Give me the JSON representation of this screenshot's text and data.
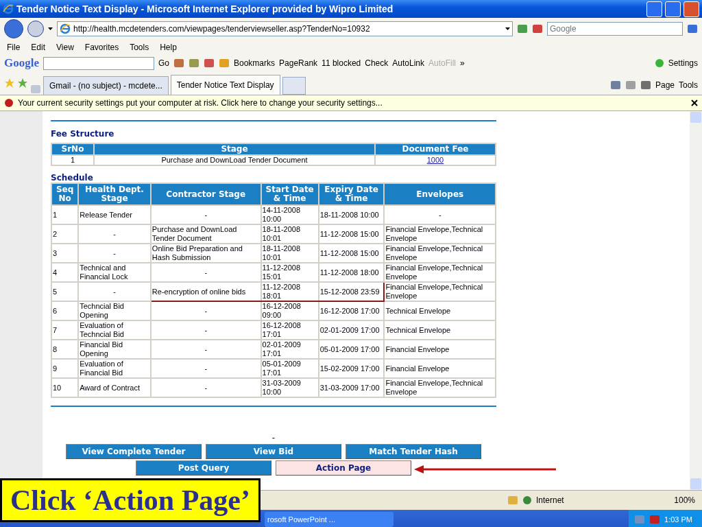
{
  "window": {
    "title": "Tender Notice Text Display - Microsoft Internet Explorer provided by Wipro Limited"
  },
  "address_bar": {
    "url": "http://health.mcdetenders.com/viewpages/tenderviewseller.asp?TenderNo=10932",
    "search_placeholder": "Google"
  },
  "menu": [
    "File",
    "Edit",
    "View",
    "Favorites",
    "Tools",
    "Help"
  ],
  "google_toolbar": {
    "logo": "Google",
    "go": "Go",
    "items": [
      {
        "label": "Bookmarks",
        "disabled": false
      },
      {
        "label": "PageRank",
        "disabled": false
      },
      {
        "label": "11 blocked",
        "disabled": false
      },
      {
        "label": "Check",
        "disabled": false
      },
      {
        "label": "AutoLink",
        "disabled": false
      },
      {
        "label": "AutoFill",
        "disabled": true
      }
    ],
    "more": "»",
    "settings": "Settings"
  },
  "tabs": [
    {
      "label": "Gmail - (no subject) - mcdete...",
      "selected": false
    },
    {
      "label": "Tender Notice Text Display",
      "selected": true
    }
  ],
  "command_bar": [
    "Page",
    "Tools"
  ],
  "security_bar": {
    "message": "Your current security settings put your computer at risk. Click here to change your security settings..."
  },
  "fee_structure": {
    "heading": "Fee Structure",
    "columns": [
      "SrNo",
      "Stage",
      "Document Fee"
    ],
    "rows": [
      [
        "1",
        "Purchase and DownLoad Tender Document",
        "1000"
      ]
    ]
  },
  "schedule": {
    "heading": "Schedule",
    "columns": [
      "Seq No",
      "Health Dept. Stage",
      "Contractor Stage",
      "Start Date & Time",
      "Expiry Date & Time",
      "Envelopes"
    ],
    "rows": [
      {
        "cells": [
          "1",
          "Release Tender",
          "-",
          "14-11-2008 10:00",
          "18-11-2008 10:00",
          "-"
        ],
        "highlighted": false
      },
      {
        "cells": [
          "2",
          "-",
          "Purchase and DownLoad Tender Document",
          "18-11-2008 10:01",
          "11-12-2008 15:00",
          "Financial Envelope,Technical Envelope"
        ],
        "highlighted": false
      },
      {
        "cells": [
          "3",
          "-",
          "Online Bid Preparation and Hash Submission",
          "18-11-2008 10:01",
          "11-12-2008 15:00",
          "Financial Envelope,Technical Envelope"
        ],
        "highlighted": false
      },
      {
        "cells": [
          "4",
          "Technical and Financial Lock",
          "-",
          "11-12-2008 15:01",
          "11-12-2008 18:00",
          "Financial Envelope,Technical Envelope"
        ],
        "highlighted": false
      },
      {
        "cells": [
          "5",
          "-",
          "Re-encryption of online bids",
          "11-12-2008 18:01",
          "15-12-2008 23:59",
          "Financial Envelope,Technical Envelope"
        ],
        "highlighted": true
      },
      {
        "cells": [
          "6",
          "Techncial Bid Opening",
          "-",
          "16-12-2008 09:00",
          "16-12-2008 17:00",
          "Technical Envelope"
        ],
        "highlighted": false
      },
      {
        "cells": [
          "7",
          "Evaluation of Techncial Bid",
          "-",
          "16-12-2008 17:01",
          "02-01-2009 17:00",
          "Technical Envelope"
        ],
        "highlighted": false
      },
      {
        "cells": [
          "8",
          "Financial Bid Opening",
          "-",
          "02-01-2009 17:01",
          "05-01-2009 17:00",
          "Financial Envelope"
        ],
        "highlighted": false
      },
      {
        "cells": [
          "9",
          "Evaluation of Financial Bid",
          "-",
          "05-01-2009 17:01",
          "15-02-2009 17:00",
          "Financial Envelope"
        ],
        "highlighted": false
      },
      {
        "cells": [
          "10",
          "Award of Contract",
          "-",
          "31-03-2009 10:00",
          "31-03-2009 17:00",
          "Financial Envelope,Technical Envelope"
        ],
        "highlighted": false
      }
    ]
  },
  "dash": "-",
  "button_rows": [
    [
      {
        "label": "View Complete Tender",
        "highlighted": false
      },
      {
        "label": "View Bid",
        "highlighted": false
      },
      {
        "label": "Match Tender Hash",
        "highlighted": false
      }
    ],
    [
      {
        "label": "Post Query",
        "highlighted": false
      },
      {
        "label": "Action Page",
        "highlighted": true
      }
    ]
  ],
  "callout": "Click ‘Action Page’",
  "status_bar": {
    "zone": "Internet",
    "zoom": "100%"
  },
  "taskbar": {
    "buttons": [
      "rosoft PowerPoint ..."
    ],
    "clock": "1:03 PM"
  }
}
